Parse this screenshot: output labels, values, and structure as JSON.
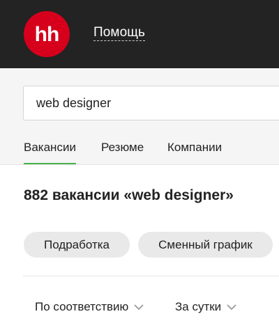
{
  "header": {
    "logo_text": "hh",
    "help_link": "Помощь"
  },
  "search": {
    "value": "web designer"
  },
  "tabs": [
    {
      "label": "Вакансии",
      "active": true
    },
    {
      "label": "Резюме",
      "active": false
    },
    {
      "label": "Компании",
      "active": false
    }
  ],
  "results": {
    "title": "882 вакансии «web designer»"
  },
  "filters": [
    {
      "label": "Подработка"
    },
    {
      "label": "Сменный график"
    }
  ],
  "sort": {
    "order_label": "По соответствию",
    "period_label": "За сутки"
  },
  "colors": {
    "header_bg": "#232323",
    "logo_bg": "#d6001c",
    "tab_active_underline": "#4bb24b",
    "chip_bg": "#e9e9e9"
  },
  "icons": [
    "hh-logo",
    "chevron-down-icon"
  ]
}
